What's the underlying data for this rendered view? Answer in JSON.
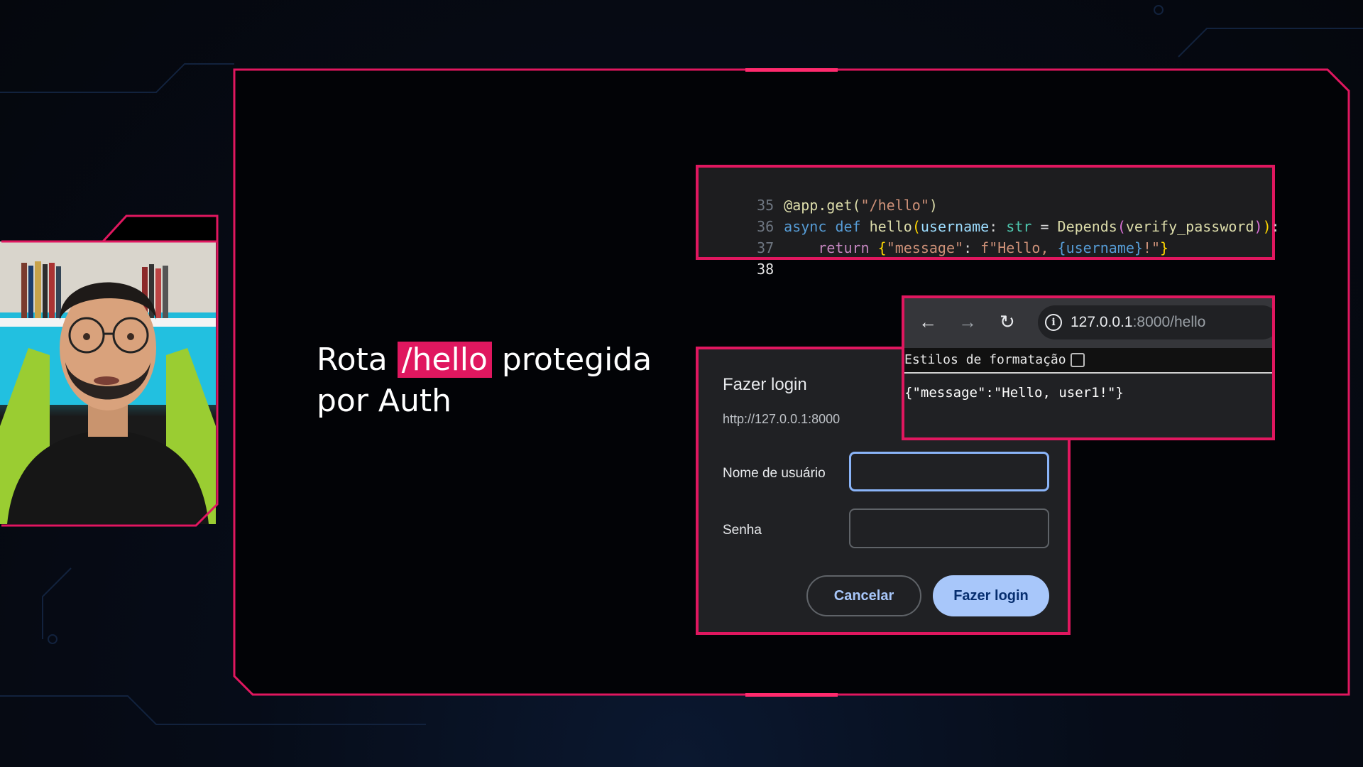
{
  "slide": {
    "headline_before": "Rota ",
    "headline_highlight": "/hello",
    "headline_after": " protegida",
    "headline_line2": "por Auth",
    "accent_color": "#e0175f"
  },
  "code": {
    "lines": [
      {
        "num": "35"
      },
      {
        "num": "36"
      },
      {
        "num": "37"
      },
      {
        "num": "38"
      }
    ],
    "tokens": {
      "decorator": "@app.get(",
      "route": "\"/hello\"",
      "close": ")",
      "async": "async",
      "def": "def",
      "fn": "hello",
      "param": "username",
      "type": "str",
      "depends": "Depends",
      "dep_arg": "verify_password",
      "return": "return",
      "key": "\"message\"",
      "fprefix": "f\"Hello, ",
      "fvar": "{username}",
      "fsuffix": "!\""
    }
  },
  "login": {
    "title": "Fazer login",
    "url": "http://127.0.0.1:8000",
    "username_label": "Nome de usuário",
    "password_label": "Senha",
    "username_value": "",
    "password_value": "",
    "cancel_label": "Cancelar",
    "submit_label": "Fazer login"
  },
  "browser": {
    "back_icon": "arrow-left",
    "forward_icon": "arrow-right",
    "reload_icon": "reload",
    "info_icon": "info-circle",
    "host": "127.0.0.1",
    "path": ":8000/hello",
    "pretty_print_label": "Estilos de formatação",
    "response": "{\"message\":\"Hello, user1!\"}"
  }
}
